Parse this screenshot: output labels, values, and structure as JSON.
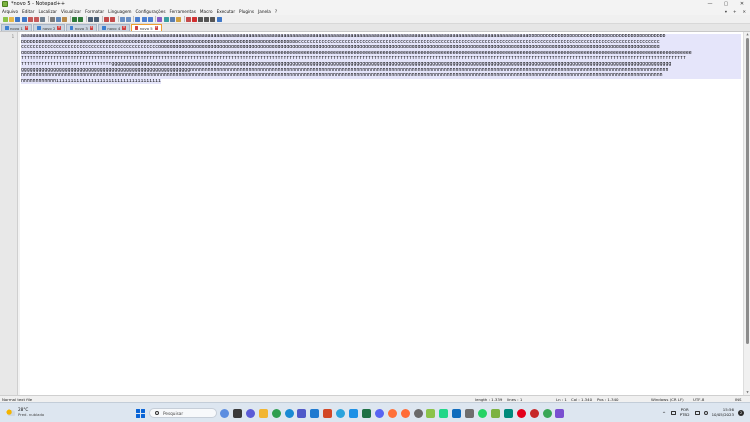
{
  "window": {
    "title": "*novo 5 - Notepad++",
    "controls": {
      "minimize": "—",
      "maximize": "▢",
      "close": "✕"
    }
  },
  "menubar": {
    "items": [
      "Arquivo",
      "Editar",
      "Localizar",
      "Visualizar",
      "Formatar",
      "Linguagem",
      "Configurações",
      "Ferramentas",
      "Macro",
      "Executar",
      "Plugins",
      "Janela",
      "?"
    ],
    "doc_controls": {
      "dropdown": "▾",
      "plus": "+",
      "close": "✕"
    }
  },
  "toolbar": {
    "buttons": [
      {
        "name": "new-file-icon",
        "color": "#8bc34a"
      },
      {
        "name": "open-folder-icon",
        "color": "#e6b84a"
      },
      {
        "name": "save-icon",
        "color": "#3f77c7"
      },
      {
        "name": "save-all-icon",
        "color": "#3f77c7"
      },
      {
        "name": "close-icon",
        "color": "#c55a5a"
      },
      {
        "name": "close-all-icon",
        "color": "#c55a5a"
      },
      {
        "name": "print-icon",
        "color": "#6f7f8f"
      },
      {
        "sep": true
      },
      {
        "name": "cut-icon",
        "color": "#7a7a7a"
      },
      {
        "name": "copy-icon",
        "color": "#5f87b8"
      },
      {
        "name": "paste-icon",
        "color": "#b88a4a"
      },
      {
        "sep": true
      },
      {
        "name": "undo-icon",
        "color": "#2f7a3a"
      },
      {
        "name": "redo-icon",
        "color": "#2f7a3a"
      },
      {
        "sep": true
      },
      {
        "name": "find-icon",
        "color": "#4c5f74"
      },
      {
        "name": "replace-icon",
        "color": "#4c5f74"
      },
      {
        "sep": true
      },
      {
        "name": "zoom-in-icon",
        "color": "#c34a4a"
      },
      {
        "name": "zoom-out-icon",
        "color": "#c34a4a"
      },
      {
        "sep": true
      },
      {
        "name": "sync-vertical-icon",
        "color": "#6a8fc4"
      },
      {
        "name": "sync-horizontal-icon",
        "color": "#6a8fc4"
      },
      {
        "sep": true
      },
      {
        "name": "word-wrap-icon",
        "color": "#4c7fd0"
      },
      {
        "name": "show-all-chars-icon",
        "color": "#4c7fd0"
      },
      {
        "name": "indent-guide-icon",
        "color": "#4c7fd0"
      },
      {
        "sep": true
      },
      {
        "name": "udl-icon",
        "color": "#8a5cc4"
      },
      {
        "name": "doc-map-icon",
        "color": "#3aa0a0"
      },
      {
        "name": "function-list-icon",
        "color": "#5a7fb0"
      },
      {
        "name": "folder-workspace-icon",
        "color": "#d0a040"
      },
      {
        "sep": true
      },
      {
        "name": "monitoring-icon",
        "color": "#c44a4a"
      },
      {
        "name": "record-macro-icon",
        "color": "#d03030"
      },
      {
        "name": "stop-macro-icon",
        "color": "#555555"
      },
      {
        "name": "play-macro-icon",
        "color": "#555555"
      },
      {
        "name": "run-macro-multiple-icon",
        "color": "#555555"
      },
      {
        "name": "save-macro-icon",
        "color": "#3f77c7"
      }
    ]
  },
  "tabs": [
    {
      "label": "novo 1",
      "active": false
    },
    {
      "label": "novo 2",
      "active": false
    },
    {
      "label": "novo 3",
      "active": false
    },
    {
      "label": "novo 4",
      "active": false
    },
    {
      "label": "novo 5",
      "active": true
    }
  ],
  "tab_close_glyph": "✕",
  "editor": {
    "line_number": "1",
    "text_lines": [
      "aaaaaaaaaaaaaaaaaaaaaaaaaaaaaaaaaaaaaaaaaaaaaaaaaaaaaaaaaaaaaaaaaaaaaaaaaaaaaaaaaaaaaaaaaaaaaaaaaaaaaaaaaaaaaaaaaaaaaaaaaaaaaaaaaaaaaaaaaaaaaaaaaaaaaaaaaaaaaaaaaaaaaaaaaaaaaabbbbbbbbbbbbbbbbbbbbbbbbbbbbbbbbbbbbbbbbbbbbbbb",
      "bbbbbbbbbbbbbbbbbbbbbbbbbbbbbbbbbbbbbbbbbbbbbbbbbbbbbbbbbbbbbbbbbbbbbbbbbbbbbbbbbbbbbbbbbbbbbbbcccccccccccccccccccccccccccccccccccccccccccccccccccccccccccccccccccccccccccccccccccccccccccccccccccccccccccccccccccccccccccc",
      "cccccccccccccccccccccccccccccccccccccccccccccccdddddddddddddddddddddddddddddddddddddddddddddddddddddddddddddddddddddddddddddddddddddddddddddddddddddddddddddddddddddddddddddddddddddddddddddddddddddddddddddddddddddddddddd",
      "dddddddddddddddddddddddddddddeeeeeeeeeeeeeeeeeeeeeeeeeeeeeeeeeeeeeeeeeeeeeeeeeeeeeeeeeeeeeeeeeeeeeeeeeeeeeeeeeeeeeeeeeeeeeeeeeeeeeeeeeeeeeeeeeeeeeeeeeeeeeeeeeeeeeeeeeeeeeeeeeeeeeeeeeeeeeeeeeeeeeeeeeeeeeeeeeeeeeeeeeeeeeeeeeeeeeeeee",
      "ffffffffffffffffffffffffffffffffffffffffffffffffffffffffffffffffffffffffffffffffffffffffffffffffffffffffffffffffffffffffffffffffffffffffffffffffffffffffffffffffffffffffffffffffffffffffffffffffffffffffffffffffffffffffffffffffffff",
      "fffffffffffffffffffffffffffffffgggggggggggggggggggggggggggggggggggggggggggggggggggggggggggggggggggggggggggggggggggggggggggggggggggggggggggggggggggggggggggggggggggggggggggggggggggggggggggggggggggggggggggggggggggggggggggggggg",
      "gggggggggggggggggggggggggggggggggggggggggggggggggggggggggghhhhhhhhhhhhhhhhhhhhhhhhhhhhhhhhhhhhhhhhhhhhhhhhhhhhhhhhhhhhhhhhhhhhhhhhhhhhhhhhhhhhhhhhhhhhhhhhhhhhhhhhhhhhhhhhhhhhhhhhhhhhhhhhhhhhhhhhhhhhhhhhhhhhhhhhhhhhhhhhhhhh",
      "hhhhhhhhhhhhhhhhhhhhhhhhhhhhhhhhhhhhhhhhhhhhhhhhhhhhhhhhhhhhhhhhhhhhhhhhhhhhhhhhhhhhhhhhhhhhhhhhhhhhhhhhhhhhhhhhhhhhhhhhhhhhhhhhhhhhhhhhhhhhhhhhhhhhhhhhhhhhhhhhhhhhhhhhhhhhhhhhhhhhhhhhhhhhhhhhhhhhhhhhhhhhhhhhhhhhhhhhhhhh",
      "hhhhhhhhhhhhiiiiiiiiiiiiiiiiiiiiiiiiiiiiiiiiiiii"
    ]
  },
  "statusbar": {
    "file_type": "Normal text file",
    "length": "length : 1.339",
    "lines": "lines : 1",
    "ln": "Ln : 1",
    "col": "Col : 1.340",
    "pos": "Pos : 1.340",
    "eol": "Windows (CR LF)",
    "encoding": "UTF-8",
    "mode": "INS"
  },
  "taskbar": {
    "weather_temp": "28°C",
    "weather_desc": "Pred. nublado",
    "search_placeholder": "Pesquisar",
    "apps": [
      {
        "name": "copilot-icon",
        "color": "#5b8de0",
        "round": true
      },
      {
        "name": "task-view-icon",
        "color": "#3a3a3a"
      },
      {
        "name": "chat-icon",
        "color": "#5b5bd6",
        "round": true
      },
      {
        "name": "file-explorer-icon",
        "color": "#f2b632"
      },
      {
        "name": "chrome-icon",
        "color": "#2f9e4f",
        "round": true
      },
      {
        "name": "edge-icon",
        "color": "#1a8ad4",
        "round": true
      },
      {
        "name": "teams-icon",
        "color": "#5059c9"
      },
      {
        "name": "vscode-icon",
        "color": "#1f7ad0"
      },
      {
        "name": "powerpoint-icon",
        "color": "#d24726"
      },
      {
        "name": "telegram-icon",
        "color": "#2aa3dc",
        "round": true
      },
      {
        "name": "docker-icon",
        "color": "#1d91e6"
      },
      {
        "name": "excel-icon",
        "color": "#1e7145"
      },
      {
        "name": "discord-icon",
        "color": "#5865f2",
        "round": true
      },
      {
        "name": "firefox-icon",
        "color": "#ff7139",
        "round": true
      },
      {
        "name": "postman-icon",
        "color": "#ff6c37",
        "round": true
      },
      {
        "name": "obs-icon",
        "color": "#6a6a6a",
        "round": true
      },
      {
        "name": "notepadpp-icon",
        "color": "#8bc34a"
      },
      {
        "name": "pycharm-icon",
        "color": "#21d789"
      },
      {
        "name": "outlook-icon",
        "color": "#0f6cbd"
      },
      {
        "name": "notes-icon",
        "color": "#6e6e6e"
      },
      {
        "name": "whatsapp-icon",
        "color": "#25d366",
        "round": true
      },
      {
        "name": "notepad-icon",
        "color": "#7cb342"
      },
      {
        "name": "meet-icon",
        "color": "#00897b"
      },
      {
        "name": "opera-icon",
        "color": "#e3001b",
        "round": true
      },
      {
        "name": "antivirus-icon",
        "color": "#c62828",
        "round": true
      },
      {
        "name": "store-icon",
        "color": "#3aa655",
        "round": true
      },
      {
        "name": "snipping-icon",
        "color": "#7a4fd0"
      }
    ],
    "tray": {
      "chevron": "^",
      "lang_top": "POR",
      "lang_bottom": "PTB2",
      "time": "15:56",
      "date": "10/05/2023",
      "notification_count": "2"
    }
  }
}
